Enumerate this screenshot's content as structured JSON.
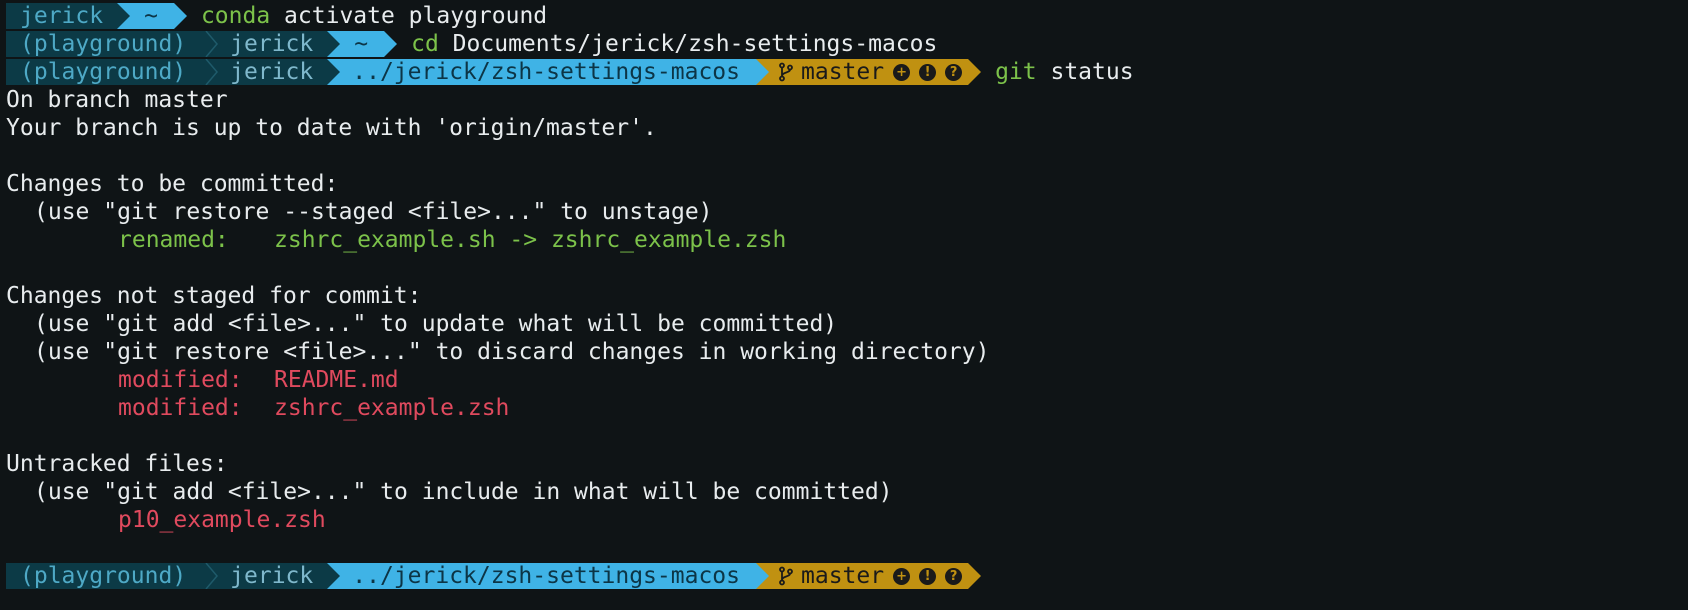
{
  "colors": {
    "background": "#0f1416",
    "env_segment": "#0c3a46",
    "dir_segment": "#3fb3e6",
    "git_segment": "#c09111",
    "staged": "#7cc24a",
    "unstaged": "#e04a5e"
  },
  "prompts": [
    {
      "env": "",
      "user": "jerick",
      "dir": "~",
      "branch": "",
      "command_keyword": "conda",
      "command_args": " activate playground"
    },
    {
      "env": "(playground)",
      "user": "jerick",
      "dir": "~",
      "branch": "",
      "command_keyword": "cd",
      "command_args": " Documents/jerick/zsh-settings-macos"
    },
    {
      "env": "(playground)",
      "user": "jerick",
      "dir": "../jerick/zsh-settings-macos",
      "branch": "master",
      "command_keyword": "git",
      "command_args": " status"
    },
    {
      "env": "(playground)",
      "user": "jerick",
      "dir": "../jerick/zsh-settings-macos",
      "branch": "master",
      "command_keyword": "",
      "command_args": ""
    }
  ],
  "git_badges": [
    "plus-circle-icon",
    "exclamation-circle-icon",
    "question-circle-icon"
  ],
  "git_branch_icon": "git-branch-icon",
  "output": {
    "line1": "On branch master",
    "line2": "Your branch is up to date with 'origin/master'.",
    "staged_header": "Changes to be committed:",
    "staged_hint": "(use \"git restore --staged <file>...\" to unstage)",
    "staged_file_label": "renamed:",
    "staged_file_value": "zshrc_example.sh -> zshrc_example.zsh",
    "unstaged_header": "Changes not staged for commit:",
    "unstaged_hint1": "(use \"git add <file>...\" to update what will be committed)",
    "unstaged_hint2": "(use \"git restore <file>...\" to discard changes in working directory)",
    "modified_label": "modified:",
    "modified_file1": "README.md",
    "modified_file2": "zshrc_example.zsh",
    "untracked_header": "Untracked files:",
    "untracked_hint": "(use \"git add <file>...\" to include in what will be committed)",
    "untracked_file": "p10_example.zsh"
  }
}
